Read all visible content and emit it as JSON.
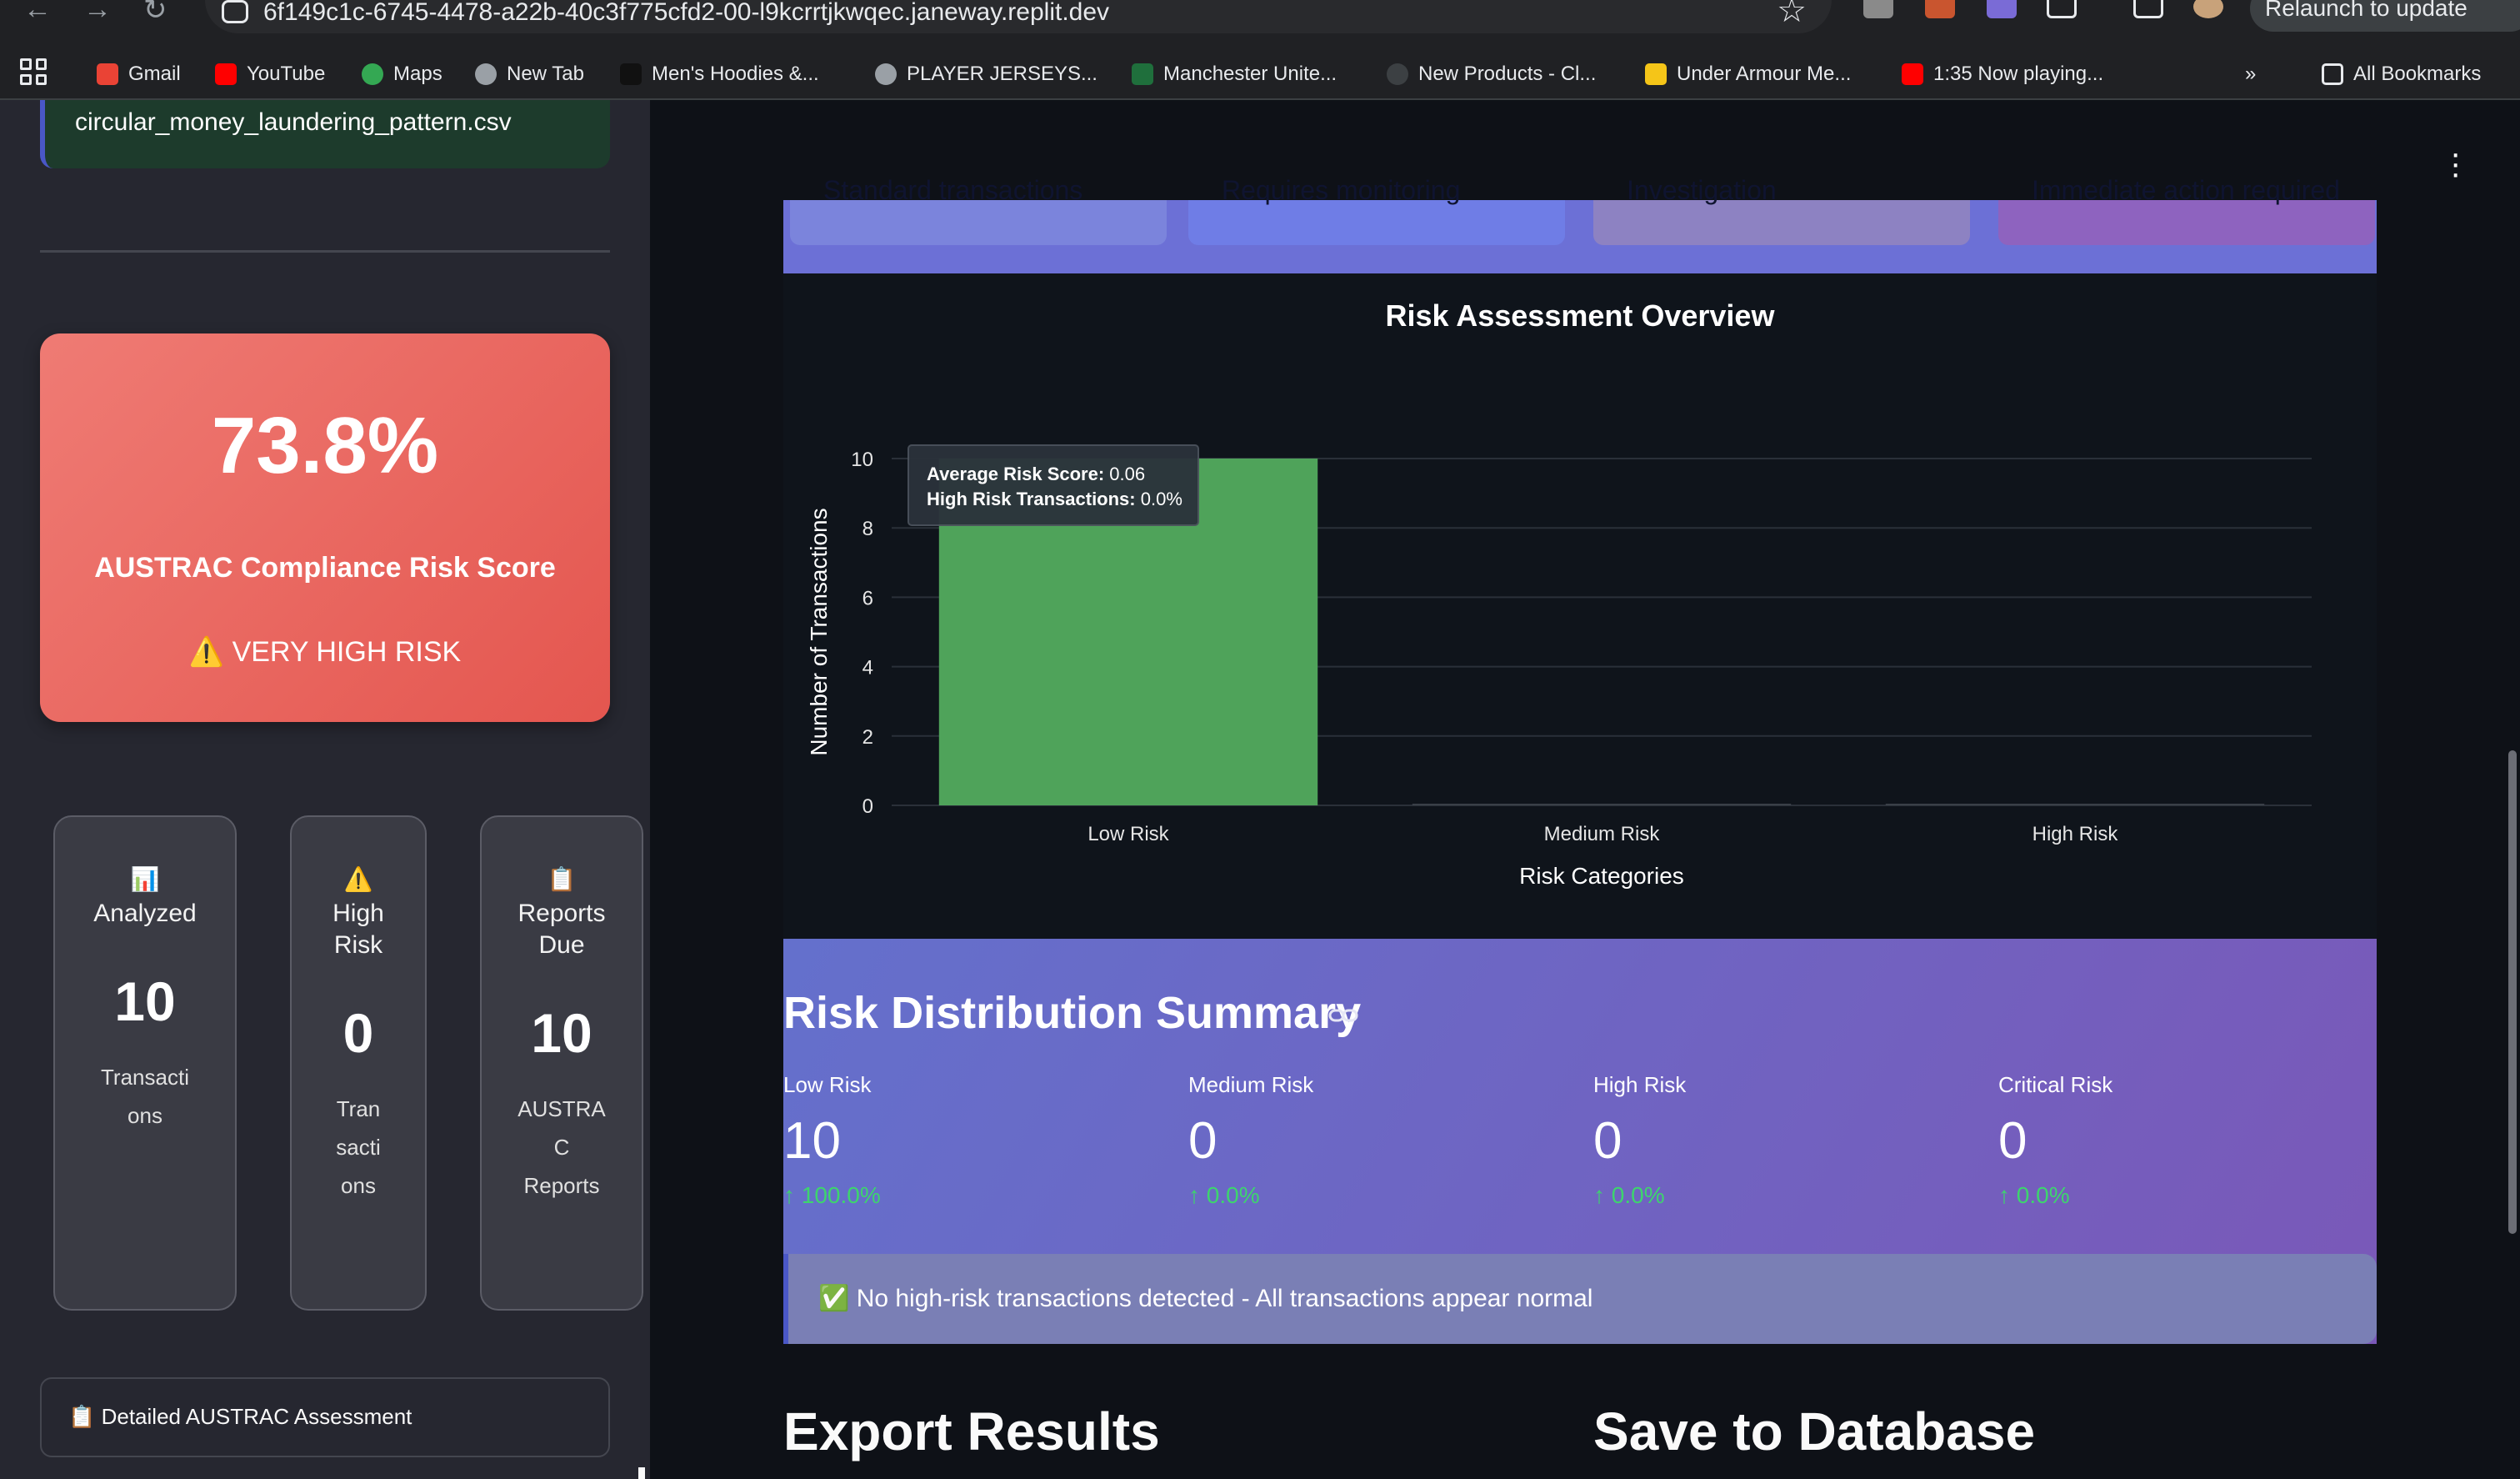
{
  "browser": {
    "url": "6f149c1c-6745-4478-a22b-40c3f775cfd2-00-l9kcrrtjkwqec.janeway.replit.dev",
    "relaunch_label": "Relaunch to update",
    "bookmarks": [
      {
        "label": "Gmail",
        "icon": "gmail-icon",
        "color": "#ea4335"
      },
      {
        "label": "YouTube",
        "icon": "youtube-icon",
        "color": "#ff0000"
      },
      {
        "label": "Maps",
        "icon": "maps-icon",
        "color": "#34a853"
      },
      {
        "label": "New Tab",
        "icon": "globe-icon",
        "color": "#9aa0a6"
      },
      {
        "label": "Men's Hoodies &...",
        "icon": "brand-icon",
        "color": "#111111"
      },
      {
        "label": "PLAYER JERSEYS...",
        "icon": "globe-icon",
        "color": "#9aa0a6"
      },
      {
        "label": "Manchester Unite...",
        "icon": "brand-icon",
        "color": "#1f6f3c"
      },
      {
        "label": "New Products - Cl...",
        "icon": "shield-icon",
        "color": "#3c4043"
      },
      {
        "label": "Under Armour Me...",
        "icon": "brand-icon",
        "color": "#f5c518"
      },
      {
        "label": "1:35 Now playing...",
        "icon": "youtube-icon",
        "color": "#ff0000"
      }
    ],
    "more_label": "»",
    "all_bookmarks": "All Bookmarks"
  },
  "sidebar": {
    "file_name": "circular_money_laundering_pattern.csv",
    "risk_score": "73.8%",
    "risk_label": "AUSTRAC Compliance Risk Score",
    "risk_level": "⚠️ VERY HIGH RISK",
    "stats": [
      {
        "icon": "📊",
        "title": "Analyzed",
        "value": "10",
        "sub": "Transacti\nons"
      },
      {
        "icon": "⚠️",
        "title": "High\nRisk",
        "value": "0",
        "sub": "Tran\nsacti\nons"
      },
      {
        "icon": "📋",
        "title": "Reports\nDue",
        "value": "10",
        "sub": "AUSTRA\nC\nReports"
      }
    ],
    "expander_label": "📋 Detailed AUSTRAC Assessment"
  },
  "top_cards": [
    {
      "text": "Standard transactions",
      "color": "#7b84dc"
    },
    {
      "text": "Requires monitoring",
      "color": "#6f7de6"
    },
    {
      "text": "Investigation",
      "color": "#8d82c2"
    },
    {
      "text": "Immediate action required",
      "color": "#8e63bf"
    }
  ],
  "chart_data": {
    "type": "bar",
    "title": "Risk Assessment Overview",
    "xlabel": "Risk Categories",
    "ylabel": "Number of Transactions",
    "categories": [
      "Low Risk",
      "Medium Risk",
      "High Risk"
    ],
    "values": [
      10,
      0,
      0
    ],
    "ylim": [
      0,
      10
    ],
    "yticks": [
      0,
      2,
      4,
      6,
      8,
      10
    ],
    "bar_color": "#4fa35a",
    "grid": true,
    "tooltip": {
      "line1_label": "Average Risk Score:",
      "line1_value": "0.06",
      "line2_label": "High Risk Transactions:",
      "line2_value": "0.0%"
    }
  },
  "distribution": {
    "title": "Risk Distribution Summary",
    "metrics": [
      {
        "label": "Low Risk",
        "value": "10",
        "delta": "100.0%"
      },
      {
        "label": "Medium Risk",
        "value": "0",
        "delta": "0.0%"
      },
      {
        "label": "High Risk",
        "value": "0",
        "delta": "0.0%"
      },
      {
        "label": "Critical Risk",
        "value": "0",
        "delta": "0.0%"
      }
    ],
    "notice": "✅ No high-risk transactions detected - All transactions appear normal"
  },
  "sections": {
    "export_title": "Export Results",
    "save_title": "Save to Database"
  }
}
